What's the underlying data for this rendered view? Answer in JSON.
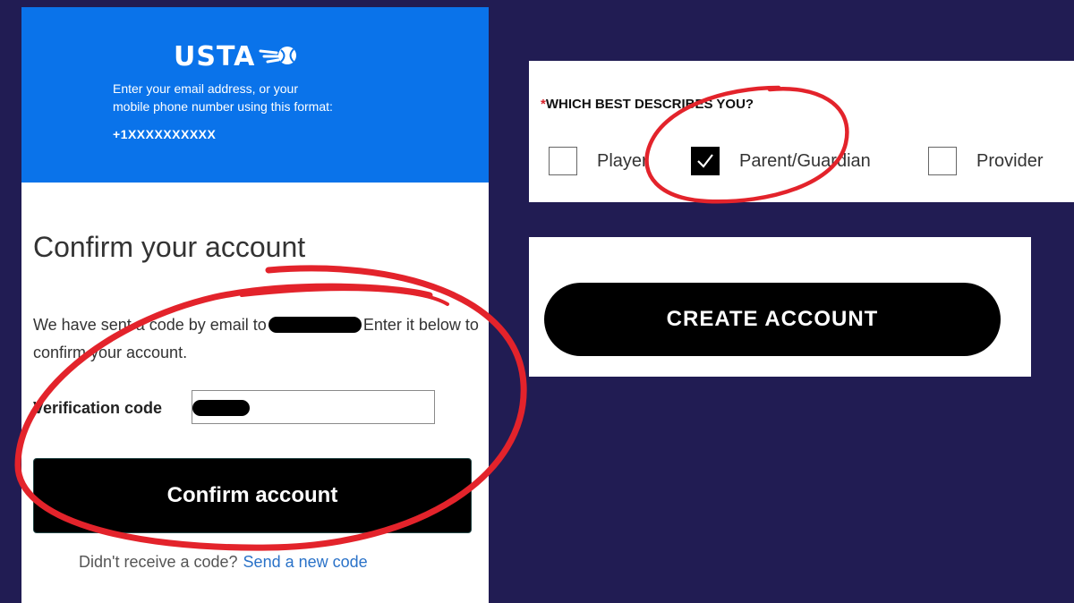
{
  "colors": {
    "background": "#211c53",
    "header_blue": "#0a73ea",
    "annotation_red": "#e3232b",
    "link_blue": "#2a72c8",
    "required_red": "#d8222a"
  },
  "login_panel": {
    "logo_text": "USTA",
    "logo_icon": "tennis-ball-flame-icon",
    "instruction_line1": "Enter your email address, or your",
    "instruction_line2": "mobile phone number using this format:",
    "phone_format": "+1XXXXXXXXXX",
    "title": "Confirm your account",
    "message_part1": "We have sent a code by email to",
    "message_part2": "Enter it below to confirm your account.",
    "code_label": "Verification code",
    "confirm_button": "Confirm account",
    "resend_prompt": "Didn't receive a code?",
    "resend_link": "Send a new code"
  },
  "describe_panel": {
    "required_marker": "*",
    "question": "WHICH BEST DESCRIBES YOU?",
    "options": [
      {
        "label": "Player",
        "checked": false
      },
      {
        "label": "Parent/Guardian",
        "checked": true
      },
      {
        "label": "Provider",
        "checked": false
      }
    ]
  },
  "create_panel": {
    "button_label": "CREATE ACCOUNT"
  }
}
